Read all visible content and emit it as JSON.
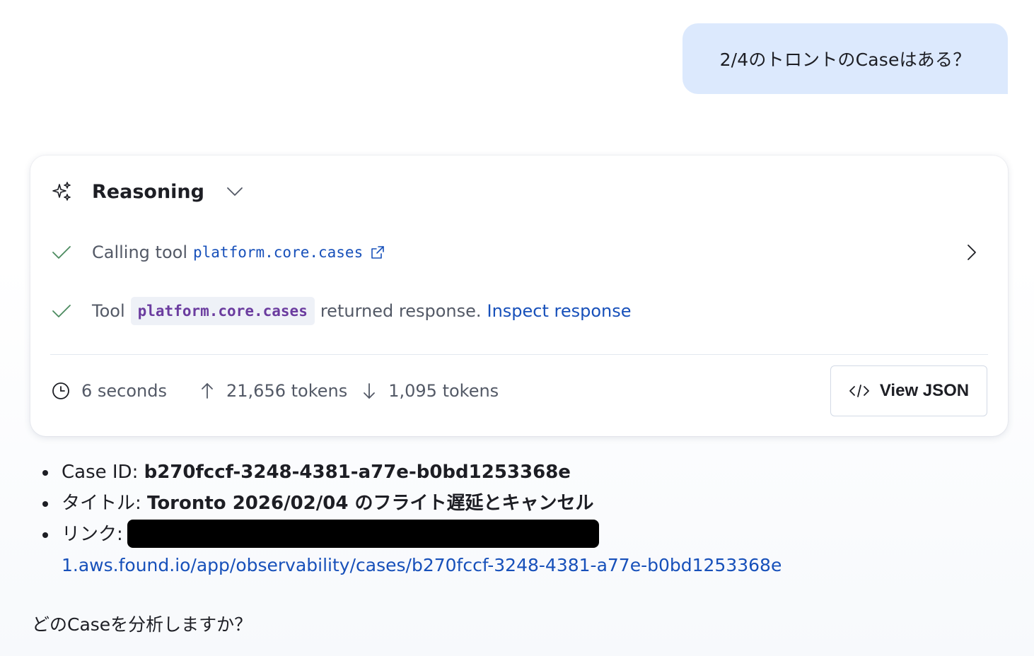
{
  "user_message": "2/4のトロントのCaseはある？",
  "reasoning": {
    "title": "Reasoning",
    "steps": [
      {
        "prefix": "Calling tool",
        "tool": "platform.core.cases"
      },
      {
        "prefix": "Tool",
        "tool": "platform.core.cases",
        "suffix": "returned response.",
        "link": "Inspect response"
      }
    ],
    "footer": {
      "duration": "6 seconds",
      "tokens_in": "21,656 tokens",
      "tokens_out": "1,095 tokens",
      "view_json_label": "View JSON"
    }
  },
  "answer": {
    "items": [
      {
        "label": "Case ID:",
        "value": "b270fccf-3248-4381-a77e-b0bd1253368e"
      },
      {
        "label": "タイトル:",
        "value": "Toronto 2026/02/04 のフライト遅延とキャンセル"
      },
      {
        "label": "リンク:",
        "url": "1.aws.found.io/app/observability/cases/b270fccf-3248-4381-a77e-b0bd1253368e"
      }
    ],
    "followup": "どのCaseを分析しますか？"
  },
  "colors": {
    "user_bubble": "#dce9fd",
    "link": "#1750ba",
    "check": "#4b8a5f",
    "code_chip_text": "#6b3c9f"
  }
}
